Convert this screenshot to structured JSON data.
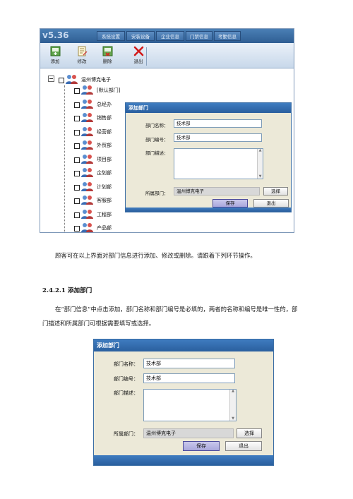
{
  "app": {
    "version": "v5.36",
    "menu": [
      "系统设置",
      "安装设备",
      "企业信息",
      "门禁信息",
      "考勤信息"
    ],
    "toolbar": [
      {
        "label": "添加",
        "icon": "add-icon"
      },
      {
        "label": "修改",
        "icon": "edit-icon"
      },
      {
        "label": "删除",
        "icon": "delete-icon"
      },
      {
        "label": "退出",
        "icon": "exit-icon"
      }
    ],
    "tree": {
      "root": "温州博克电子",
      "items": [
        "[默认部门]",
        "总经办",
        "销售部",
        "经营部",
        "外贸部",
        "项目部",
        "企划部",
        "计划部",
        "客服部",
        "工程部",
        "产品部"
      ]
    }
  },
  "dialog": {
    "title": "添加部门",
    "name_label": "部门名称：",
    "name_value": "技术部",
    "code_label": "部门编号：",
    "code_value": "技术部",
    "desc_label": "部门描述：",
    "desc_value": "",
    "parent_label": "所属部门：",
    "parent_value": "温州博克电子",
    "choose_button": "选择",
    "save_button": "保存",
    "exit_button": "退出"
  },
  "text": {
    "para1": "顾客可在以上界面对部门信息进行添加、修改或删除。请跟着下列环节操作。",
    "heading": "2.4.2.1 添加部门",
    "para2_line1": "在“部门信息”中点击添加，部门名称和部门编号是必填的，两者的名称和编号是唯一性的，部",
    "para2_line2": "门描述和所属部门可根据需要填写或选择。"
  },
  "colors": {
    "title_bar": "#2f6aad",
    "dialog_bg": "#ece9d8",
    "menubar": "#3d6ea6",
    "save_button": "#b2b0e0"
  }
}
